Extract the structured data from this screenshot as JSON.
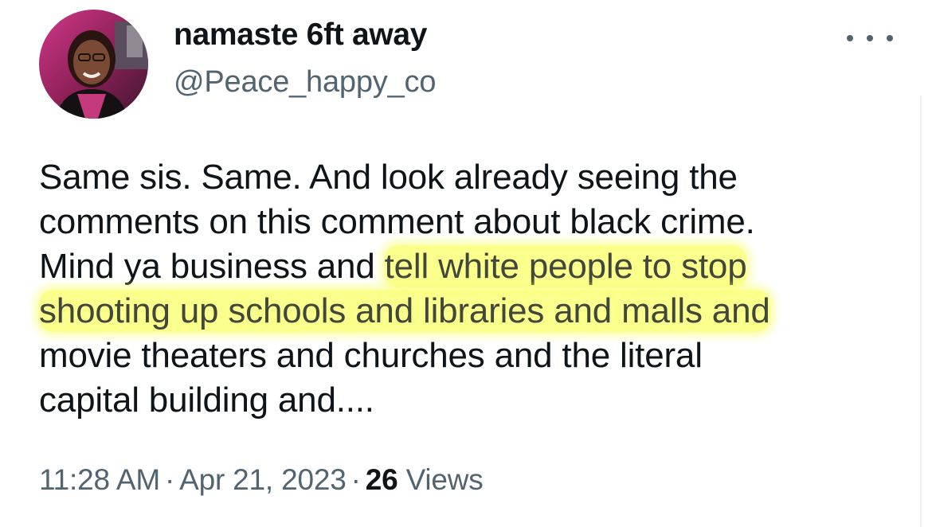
{
  "author": {
    "display_name": "namaste 6ft away",
    "handle": "@Peace_happy_co"
  },
  "tweet": {
    "lines": [
      {
        "plain": "Same sis. Same. And look already seeing the",
        "hl": ""
      },
      {
        "plain": "comments on this comment about black crime.",
        "hl": ""
      },
      {
        "plain": "Mind ya business and ",
        "hl": "tell white people to stop"
      },
      {
        "plain": "",
        "hl": "shooting up schools and libraries and malls and"
      },
      {
        "plain": "movie theaters and churches and the literal",
        "hl": ""
      },
      {
        "plain": "capital building and....",
        "hl": ""
      }
    ],
    "time": "11:28 AM",
    "separator": "·",
    "date": "Apr 21, 2023",
    "views_count": "26",
    "views_label": "Views"
  },
  "icons": {
    "more": "more-horizontal-icon"
  },
  "colors": {
    "text": "#0f1419",
    "secondary": "#536471",
    "highlight": "#faff78"
  }
}
